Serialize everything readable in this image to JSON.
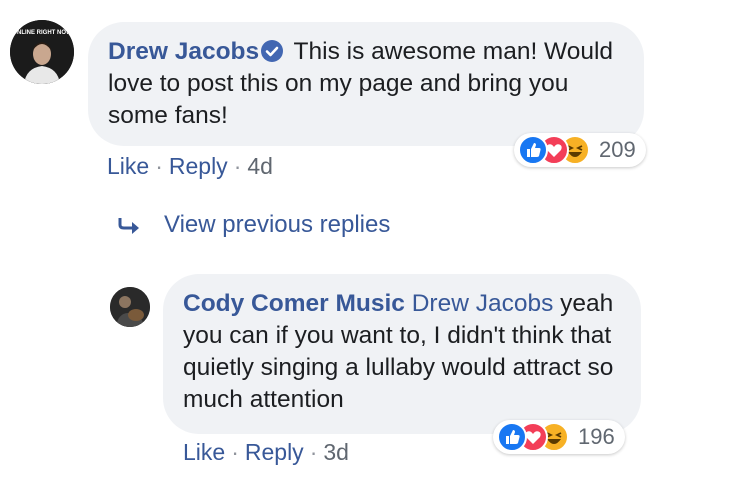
{
  "comment": {
    "author": "Drew Jacobs",
    "avatar_text": "ONLINE RIGHT NOW",
    "text": "This is awesome man! Would love to post this on my page and bring you some fans!",
    "actions": {
      "like": "Like",
      "reply": "Reply",
      "time": "4d",
      "sep": "·"
    },
    "reactions": {
      "icons": [
        "like-icon",
        "love-icon",
        "haha-icon"
      ],
      "count": "209"
    }
  },
  "view_previous": {
    "label": "View previous replies",
    "icon": "reply-arrow-icon"
  },
  "reply": {
    "author": "Cody Comer Music",
    "mention": "Drew Jacobs",
    "text": "yeah you can if you want to, I didn't think that quietly singing a lullaby would attract so much attention",
    "actions": {
      "like": "Like",
      "reply": "Reply",
      "time": "3d",
      "sep": "·"
    },
    "reactions": {
      "icons": [
        "like-icon",
        "love-icon",
        "haha-icon"
      ],
      "count": "196"
    }
  },
  "colors": {
    "link": "#385898",
    "bubble": "#f0f2f5",
    "like": "#1877f2",
    "love": "#f33e58",
    "haha": "#f7b125"
  }
}
